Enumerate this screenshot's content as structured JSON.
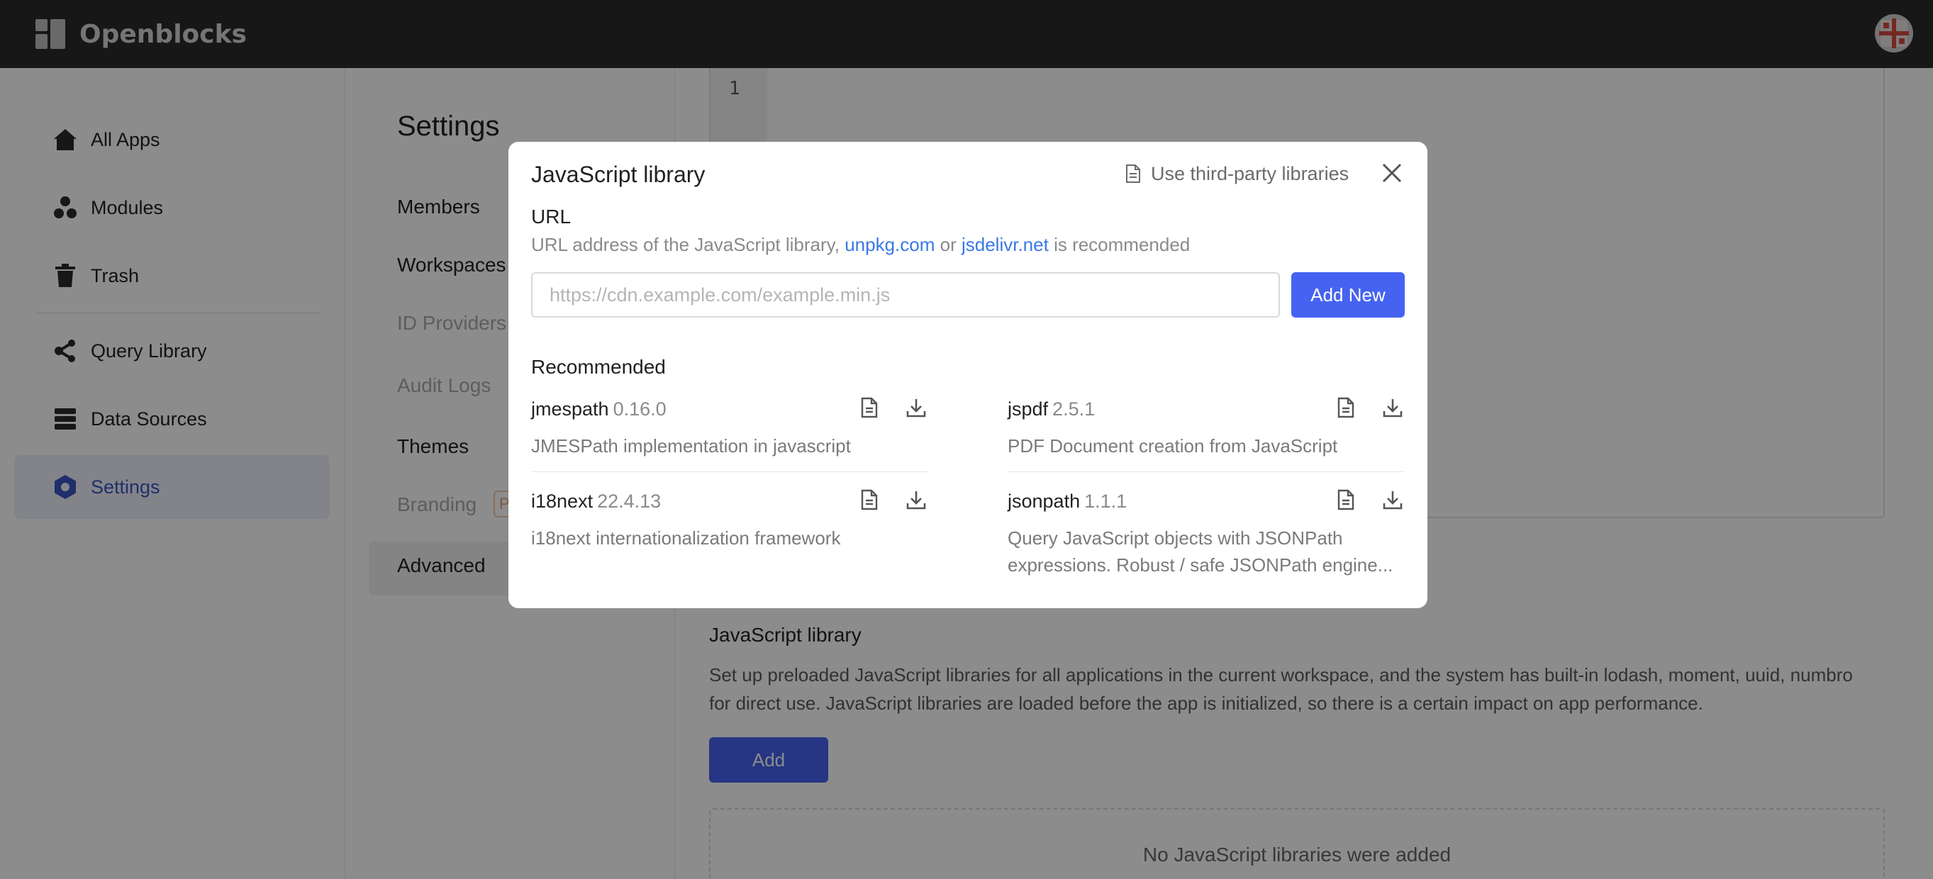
{
  "header": {
    "app_name": "Openblocks"
  },
  "sidebar": {
    "items": [
      {
        "label": "All Apps",
        "icon": "home-icon"
      },
      {
        "label": "Modules",
        "icon": "modules-icon"
      },
      {
        "label": "Trash",
        "icon": "trash-icon"
      },
      {
        "label": "Query Library",
        "icon": "query-library-icon"
      },
      {
        "label": "Data Sources",
        "icon": "data-sources-icon"
      },
      {
        "label": "Settings",
        "icon": "settings-icon",
        "active": true
      }
    ]
  },
  "settings_menu": {
    "title": "Settings",
    "items": [
      {
        "label": "Members"
      },
      {
        "label": "Workspaces"
      },
      {
        "label": "ID Providers"
      },
      {
        "label": "Audit Logs"
      },
      {
        "label": "Themes"
      },
      {
        "label": "Branding"
      },
      {
        "label": "Advanced",
        "active": true
      }
    ],
    "branding_badge": "P"
  },
  "main": {
    "editor_line_number": "1",
    "js_library_title": "JavaScript library",
    "js_library_description": "Set up preloaded JavaScript libraries for all applications in the current workspace, and the system has built-in lodash, moment, uuid, numbro for direct use. JavaScript libraries are loaded before the app is initialized, so there is a certain impact on app performance.",
    "add_button": "Add",
    "empty_message": "No JavaScript libraries were added"
  },
  "modal": {
    "title": "JavaScript library",
    "third_party_link": "Use third-party libraries",
    "url_label": "URL",
    "url_desc_prefix": "URL address of the JavaScript library,",
    "url_link1": "unpkg.com",
    "url_desc_or": "or",
    "url_link2": "jsdelivr.net",
    "url_desc_suffix": "is recommended",
    "url_placeholder": "https://cdn.example.com/example.min.js",
    "add_new_button": "Add New",
    "recommended_label": "Recommended",
    "libraries": [
      {
        "name": "jmespath",
        "version": "0.16.0",
        "description": "JMESPath implementation in javascript"
      },
      {
        "name": "jspdf",
        "version": "2.5.1",
        "description": "PDF Document creation from JavaScript"
      },
      {
        "name": "i18next",
        "version": "22.4.13",
        "description": "i18next internationalization framework"
      },
      {
        "name": "jsonpath",
        "version": "1.1.1",
        "description": "Query JavaScript objects with JSONPath expressions. Robust / safe JSONPath engine..."
      }
    ]
  },
  "colors": {
    "primary": "#4563f0",
    "link": "#3978e5",
    "header_bg": "#2b2b2b",
    "active_nav_text": "#3a57c4"
  }
}
